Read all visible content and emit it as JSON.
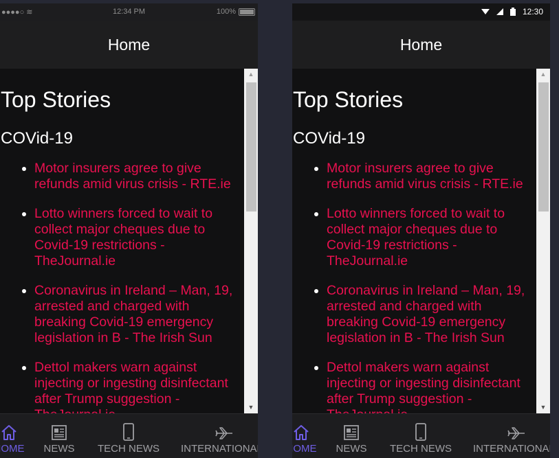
{
  "phones": {
    "ios": {
      "status": {
        "signal": "●●●●○",
        "wifi": "≋",
        "time": "12:34 PM",
        "battery": "100%"
      },
      "header_title": "Home",
      "page_title": "Top Stories",
      "section_title": "COVid-19",
      "stories": [
        "Motor insurers agree to give refunds amid virus crisis - RTE.ie",
        "Lotto winners forced to wait to collect major cheques due to Covid-19 restrictions - TheJournal.ie",
        "Coronavirus in Ireland – Man, 19, arrested and charged with breaking Covid-19 emergency legislation in B - The Irish Sun",
        "Dettol makers warn against injecting or ingesting disinfectant after Trump suggestion - TheJournal.ie"
      ],
      "tabs": [
        "HOME",
        "NEWS",
        "TECH NEWS",
        "INTERNATIONAL"
      ]
    },
    "android": {
      "status": {
        "time": "12:30"
      },
      "header_title": "Home",
      "page_title": "Top Stories",
      "section_title": "COVid-19",
      "stories": [
        "Motor insurers agree to give refunds amid virus crisis - RTE.ie",
        "Lotto winners forced to wait to collect major cheques due to Covid-19 restrictions - TheJournal.ie",
        "Coronavirus in Ireland – Man, 19, arrested and charged with breaking Covid-19 emergency legislation in B - The Irish Sun",
        "Dettol makers warn against injecting or ingesting disinfectant after Trump suggestion - TheJournal.ie"
      ],
      "tabs": [
        "HOME",
        "NEWS",
        "TECH NEWS",
        "INTERNATIONAL"
      ]
    }
  },
  "colors": {
    "accent": "#6f5ee5",
    "link": "#e8114f",
    "background": "#111112"
  }
}
